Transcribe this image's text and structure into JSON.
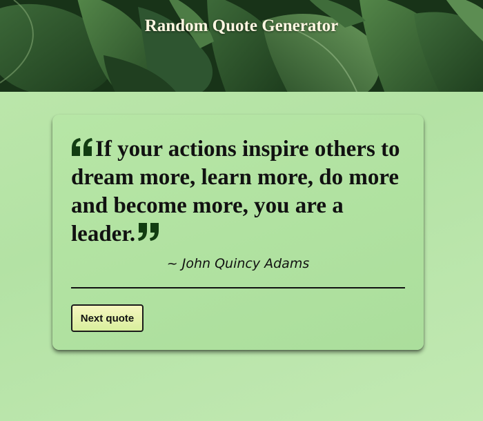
{
  "header": {
    "title": "Random Quote Generator"
  },
  "quote": {
    "text": "If your actions inspire others to dream more, learn more, do more and become more, you are a leader.",
    "author": "~ John Quincy Adams",
    "open_mark_icon": "quote-open-icon",
    "close_mark_icon": "quote-close-icon"
  },
  "actions": {
    "next_label": "Next quote"
  },
  "colors": {
    "page_background": "#b9e5a9",
    "card_background": "#b0e09f",
    "quote_mark": "#123d12",
    "header_title": "#fff7e2",
    "button_gradient_top": "#f6f6bf",
    "button_gradient_bottom": "#d8ef9d"
  }
}
